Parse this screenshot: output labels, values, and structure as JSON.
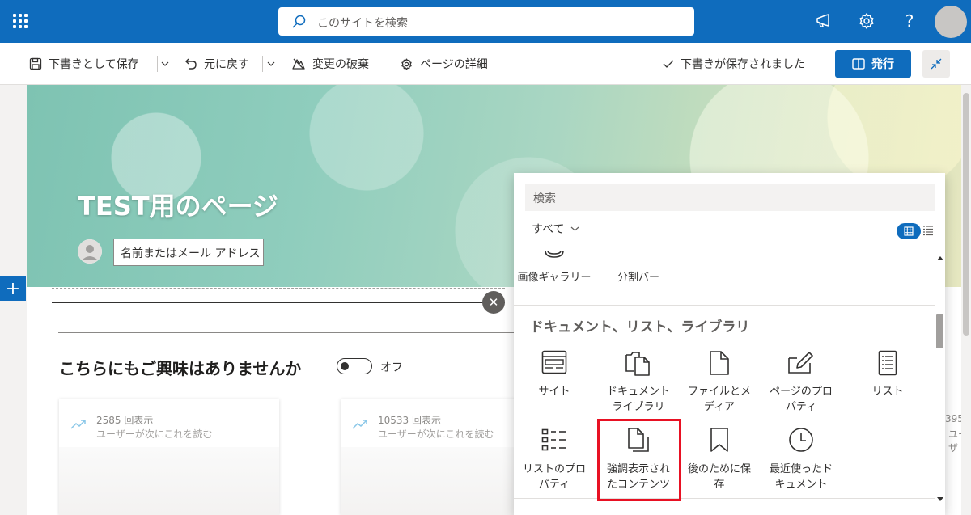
{
  "colors": {
    "brand": "#0f6cbd",
    "highlight": "#e81123"
  },
  "suitebar": {
    "search_placeholder": "このサイトを検索",
    "icons": [
      "waffle-icon",
      "megaphone-icon",
      "gear-icon",
      "help-icon",
      "avatar"
    ],
    "help_glyph": "?"
  },
  "commandbar": {
    "save_draft": "下書きとして保存",
    "undo": "元に戻す",
    "discard": "変更の破棄",
    "page_details": "ページの詳細",
    "status": "下書きが保存されました",
    "publish": "発行"
  },
  "hero": {
    "title": "TEST用のページ",
    "author_placeholder": "名前またはメール アドレス"
  },
  "section": {
    "add_glyph": "+",
    "close_glyph": "✕",
    "title": "こちらにもご興味はありませんか",
    "toggle_label": "オフ"
  },
  "cards": [
    {
      "views": "2585 回表示",
      "desc": "ユーザーが次にこれを読む"
    },
    {
      "views": "10533 回表示",
      "desc": "ユーザーが次にこれを読む"
    }
  ],
  "edge_text": {
    "num": "395",
    "desc": "ユーザ"
  },
  "toolbox": {
    "search_placeholder": "検索",
    "filter": "すべて",
    "top_items": [
      {
        "label": "画像ギャラリー",
        "icon": "image-gallery-icon"
      },
      {
        "label": "分割バー",
        "icon": "divider-icon"
      }
    ],
    "section_title": "ドキュメント、リスト、ライブラリ",
    "items": [
      {
        "label": "サイト",
        "icon": "site-icon"
      },
      {
        "label": "ドキュメントライブラリ",
        "icon": "document-library-icon"
      },
      {
        "label": "ファイルとメディア",
        "icon": "file-icon"
      },
      {
        "label": "ページのプロパティ",
        "icon": "page-properties-icon"
      },
      {
        "label": "リスト",
        "icon": "list-icon"
      },
      {
        "label": "リストのプロパティ",
        "icon": "list-properties-icon"
      },
      {
        "label": "強調表示されたコンテンツ",
        "icon": "highlighted-content-icon",
        "highlighted": true
      },
      {
        "label": "後のために保存",
        "icon": "bookmark-icon"
      },
      {
        "label": "最近使ったドキュメント",
        "icon": "clock-icon"
      }
    ]
  }
}
